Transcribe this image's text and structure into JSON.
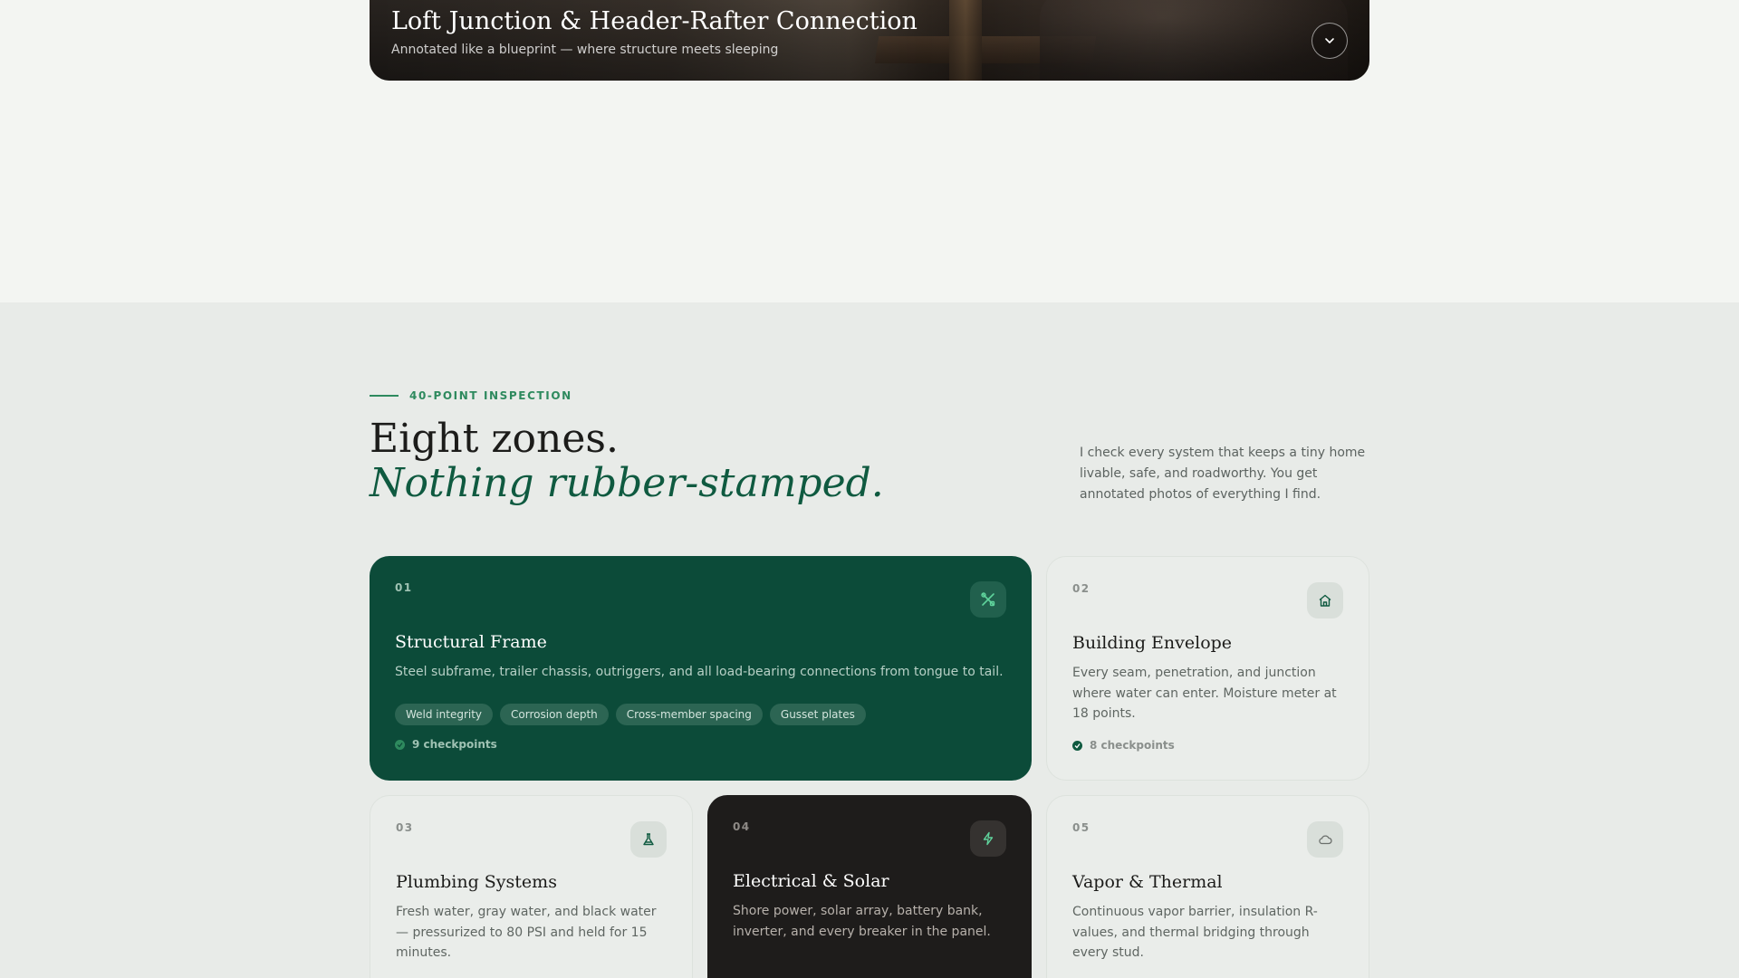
{
  "hero": {
    "title": "Loft Junction & Header-Rafter Connection",
    "subtitle": "Annotated like a blueprint — where structure meets sleeping",
    "toggle_icon": "chevron-down-icon"
  },
  "section": {
    "eyebrow": "40-POINT INSPECTION",
    "heading_line1": "Eight zones.",
    "heading_line2": "Nothing rubber-stamped.",
    "intro": "I check every system that keeps a tiny home livable, safe, and roadworthy. You get annotated photos of everything I find."
  },
  "zones": [
    {
      "number": "01",
      "title": "Structural Frame",
      "description": "Steel subframe, trailer chassis, outriggers, and all load-bearing connections from tongue to tail.",
      "tags": [
        "Weld integrity",
        "Corrosion depth",
        "Cross-member spacing",
        "Gusset plates"
      ],
      "checkpoints": "9 checkpoints",
      "icon": "tools-icon",
      "theme": "green"
    },
    {
      "number": "02",
      "title": "Building Envelope",
      "description": "Every seam, penetration, and junction where water can enter. Moisture meter at 18 points.",
      "checkpoints": "8 checkpoints",
      "icon": "house-icon",
      "theme": "light"
    },
    {
      "number": "03",
      "title": "Plumbing Systems",
      "description": "Fresh water, gray water, and black water — pressurized to 80 PSI and held for 15 minutes.",
      "icon": "flask-icon",
      "theme": "light"
    },
    {
      "number": "04",
      "title": "Electrical & Solar",
      "description": "Shore power, solar array, battery bank, inverter, and every breaker in the panel.",
      "icon": "lightning-icon",
      "theme": "dark"
    },
    {
      "number": "05",
      "title": "Vapor & Thermal",
      "description": "Continuous vapor barrier, insulation R-values, and thermal bridging through every stud.",
      "icon": "cloud-icon",
      "theme": "light"
    }
  ],
  "colors": {
    "accent_green": "#2e8a5e",
    "deep_green": "#0c4b39",
    "dark_card": "#1e1c1b"
  }
}
